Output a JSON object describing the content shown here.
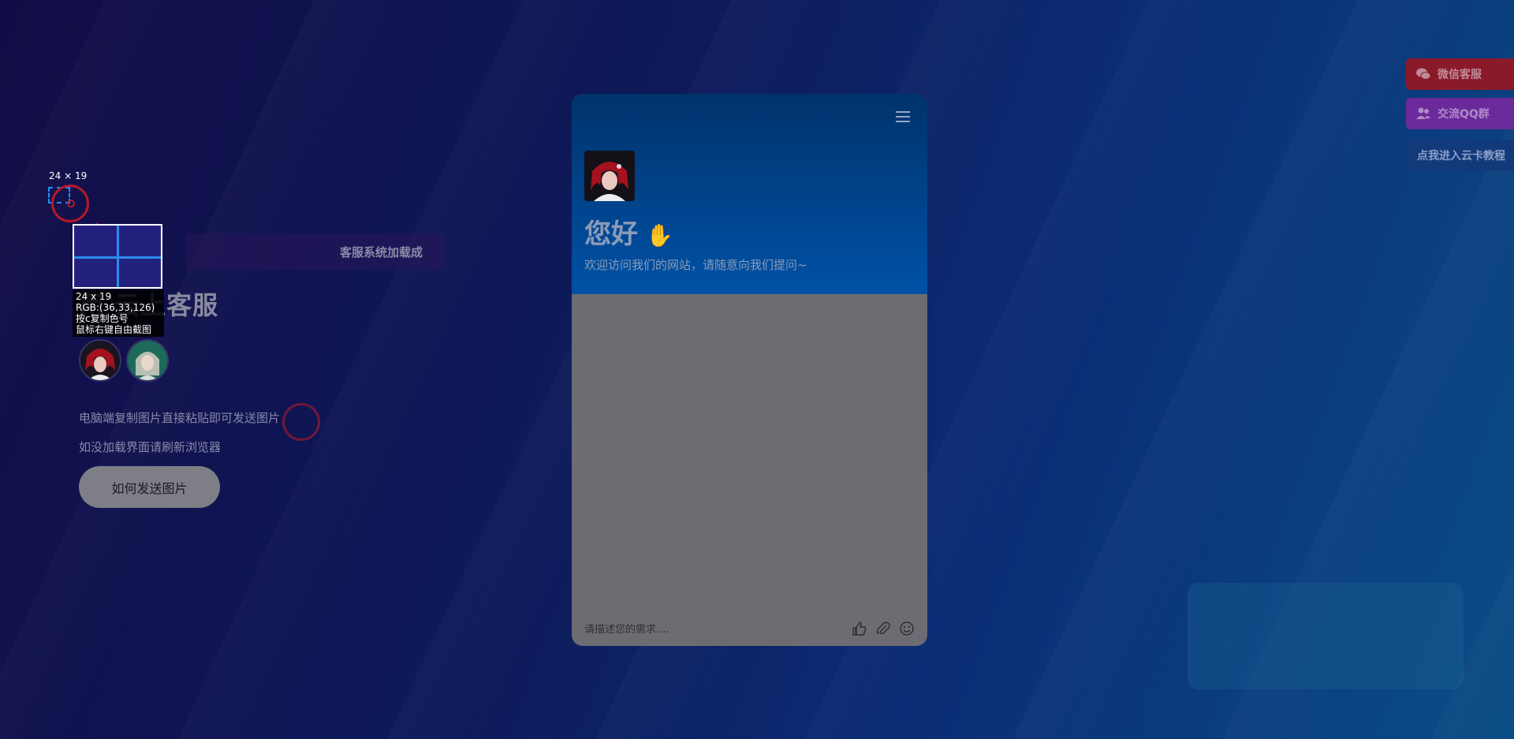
{
  "hero": {
    "loaded_banner": "客服系统加载成",
    "title": "用 云上客服",
    "line1": "电脑端复制图片直接粘贴即可发送图片",
    "line2": "如没加载界面请刷新浏览器",
    "send_image_button": "如何发送图片"
  },
  "picker": {
    "top_size": "24 × 19",
    "size": "24 x 19",
    "rgb": "RGB:(36,33,126)",
    "copy_hint": "按c复制色号",
    "capture_hint": "鼠标右键自由截图"
  },
  "chat": {
    "greeting": "您好",
    "subtitle": "欢迎访问我们的网站，请随意向我们提问~",
    "input_placeholder": "请描述您的需求...."
  },
  "side": {
    "wechat": "微信客服",
    "qq_group": "交流QQ群",
    "tutorial": "点我进入云卡教程"
  },
  "colors": {
    "picked": "#24217e",
    "chat_header": "#0051a6"
  }
}
